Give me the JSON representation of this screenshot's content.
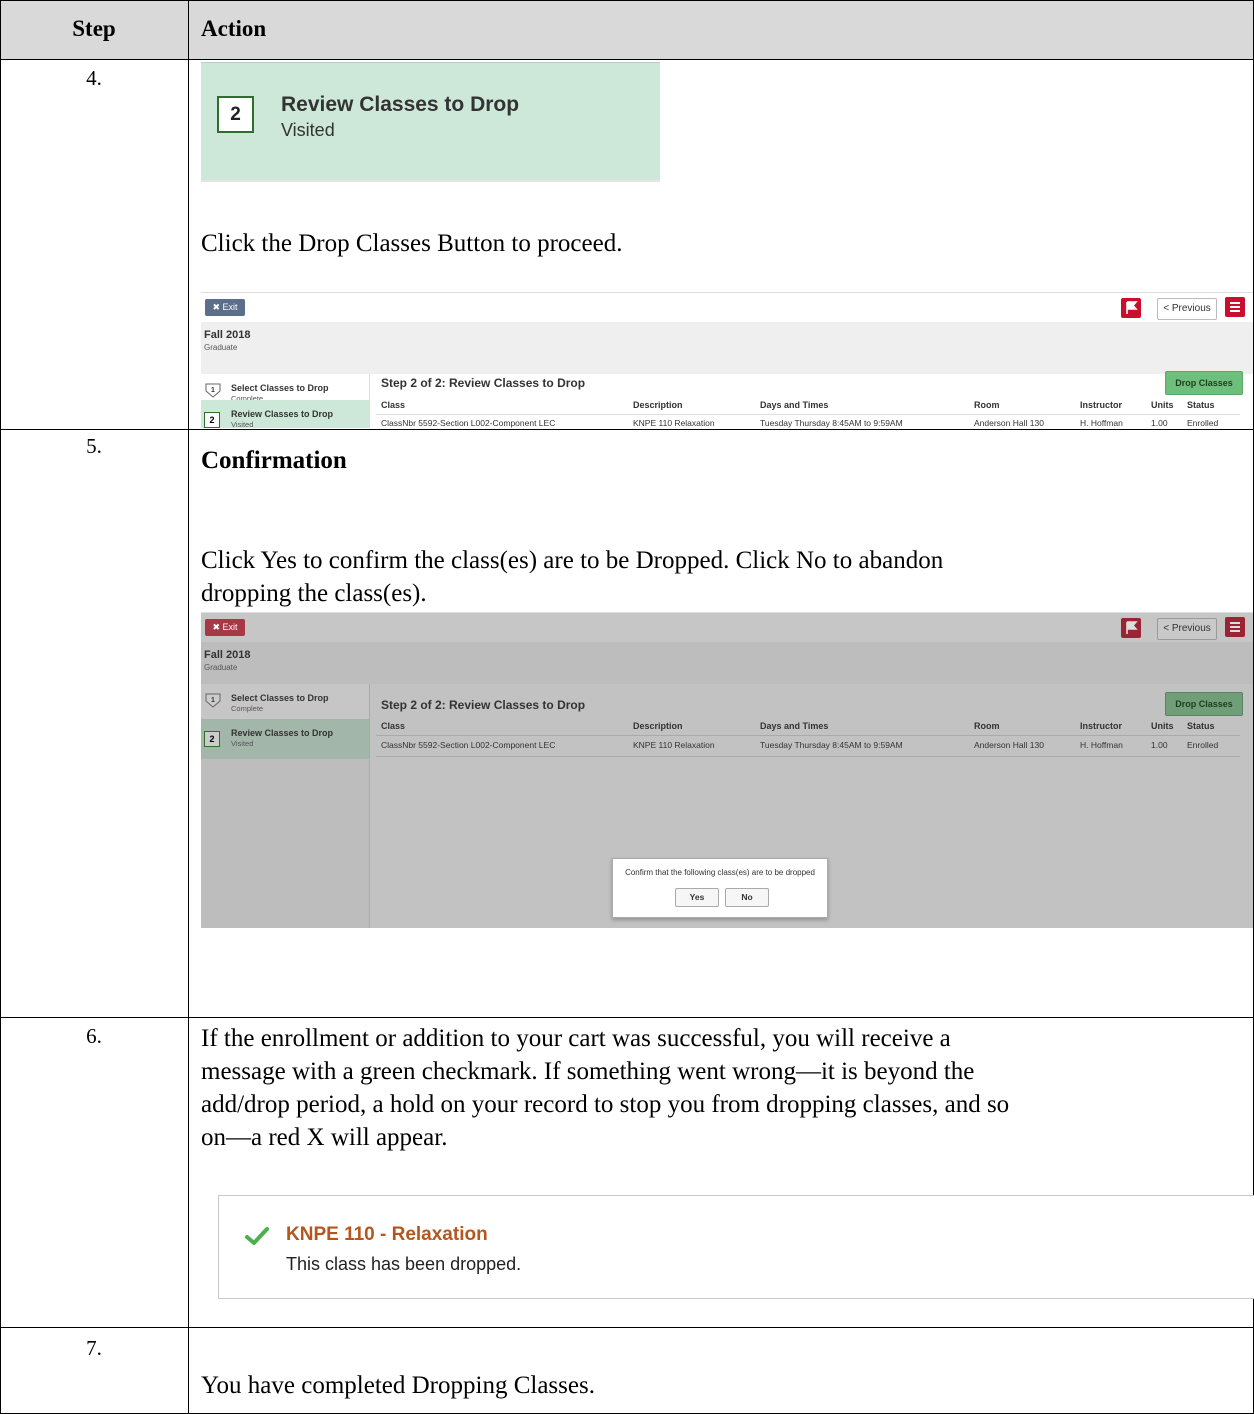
{
  "table": {
    "header_step": "Step",
    "header_action": "Action"
  },
  "rows": [
    {
      "step": "4."
    },
    {
      "step": "5."
    },
    {
      "step": "6."
    },
    {
      "step": "7."
    }
  ],
  "step4": {
    "tile_number": "2",
    "tile_title": "Review Classes to Drop",
    "tile_status": "Visited",
    "instruction": "Click the Drop Classes Button to proceed."
  },
  "app": {
    "exit_label": "Exit",
    "previous_label": "< Previous",
    "term": "Fall 2018",
    "career": "Graduate",
    "side_items": [
      {
        "number": "1",
        "title": "Select Classes to Drop",
        "status": "Complete"
      },
      {
        "number": "2",
        "title": "Review Classes to Drop",
        "status": "Visited"
      }
    ],
    "main_title": "Step 2 of 2: Review Classes to Drop",
    "drop_button": "Drop Classes",
    "columns": [
      "Class",
      "Description",
      "Days and Times",
      "Room",
      "Instructor",
      "Units",
      "Status"
    ],
    "class_row": {
      "class": "ClassNbr 5592-Section L002-Component LEC",
      "description": "KNPE 110  Relaxation",
      "days_times": "Tuesday Thursday  8:45AM to 9:59AM",
      "room": "Anderson Hall 130",
      "instructor": "H. Hoffman",
      "units": "1.00",
      "status": "Enrolled"
    }
  },
  "step5": {
    "heading": "Confirmation",
    "instruction_line1": "Click Yes to confirm the class(es) are to be Dropped. Click No to abandon",
    "instruction_line2": "dropping the class(es).",
    "dialog_text": "Confirm that the following class(es) are to be dropped",
    "yes": "Yes",
    "no": "No"
  },
  "step6": {
    "line1": "If the enrollment or addition to your cart was successful, you will receive a",
    "line2": "message with a green checkmark. If something went wrong—it is beyond the",
    "line3": "add/drop period, a hold on your record to stop you from dropping classes, and so",
    "line4": "on—a red X will appear.",
    "msg_title": "KNPE  110 - Relaxation",
    "msg_body": "This class has been dropped.",
    "check_color": "#4caf50"
  },
  "step7": {
    "text": "You have completed Dropping Classes."
  }
}
